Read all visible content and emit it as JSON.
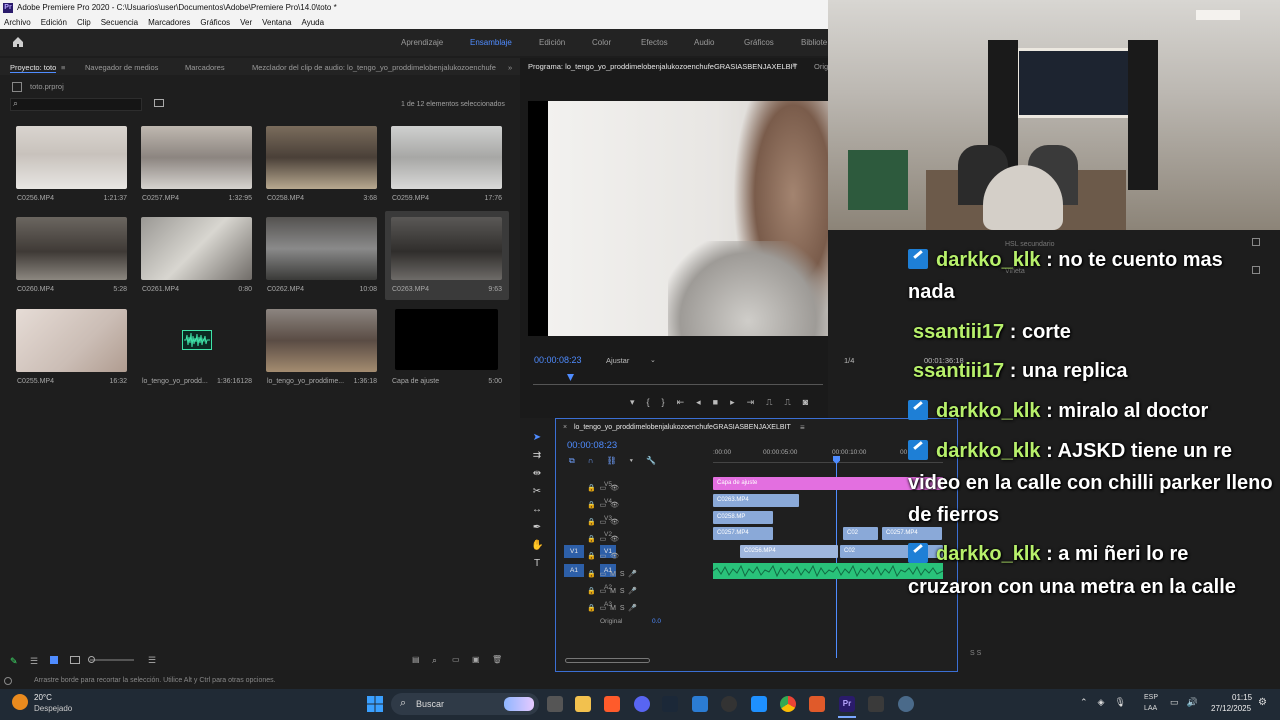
{
  "window": {
    "title": "Adobe Premiere Pro 2020 - C:\\Usuarios\\user\\Documentos\\Adobe\\Premiere Pro\\14.0\\toto *"
  },
  "menu": [
    "Archivo",
    "Edición",
    "Clip",
    "Secuencia",
    "Marcadores",
    "Gráficos",
    "Ver",
    "Ventana",
    "Ayuda"
  ],
  "workspaces": [
    "Aprendizaje",
    "Ensamblaje",
    "Edición",
    "Color",
    "Efectos",
    "Audio",
    "Gráficos",
    "Bibliote"
  ],
  "project_tabs": {
    "project": "Proyecto: toto",
    "media": "Navegador de medios",
    "markers": "Marcadores",
    "audio_mixer": "Mezclador del clip de audio: lo_tengo_yo_proddimelobenjalukozoenchufe"
  },
  "project": {
    "file": "toto.prproj",
    "selection": "1 de 12 elementos seleccionados"
  },
  "clips": [
    {
      "name": "C0256.MP4",
      "duration": "1:21:37"
    },
    {
      "name": "C0257.MP4",
      "duration": "1:32:95"
    },
    {
      "name": "C0258.MP4",
      "duration": "3:68"
    },
    {
      "name": "C0259.MP4",
      "duration": "17:76"
    },
    {
      "name": "C0260.MP4",
      "duration": "5:28"
    },
    {
      "name": "C0261.MP4",
      "duration": "0:80"
    },
    {
      "name": "C0262.MP4",
      "duration": "10:08"
    },
    {
      "name": "C0263.MP4",
      "duration": "9:63"
    },
    {
      "name": "C0255.MP4",
      "duration": "16:32"
    },
    {
      "name": "lo_tengo_yo_prodd...",
      "duration": "1:36:16128"
    },
    {
      "name": "lo_tengo_yo_proddime...",
      "duration": "1:36:18"
    },
    {
      "name": "Capa de ajuste",
      "duration": "5:00"
    }
  ],
  "program": {
    "title": "Programa: lo_tengo_yo_proddimelobenjalukozoenchufeGRASIASBENJAXELBIT",
    "orig": "Orig",
    "timecode": "00:00:08:23",
    "fit": "Ajustar",
    "fraction": "1/4",
    "duration": "00:01:36:18"
  },
  "sequence": {
    "name": "lo_tengo_yo_proddimelobenjalukozoenchufeGRASIASBENJAXELBIT",
    "timecode": "00:00:08:23",
    "ruler": [
      ":00:00",
      "00:00:05:00",
      "00:00:10:00",
      "00"
    ]
  },
  "tracks": {
    "video": [
      "V5",
      "V4",
      "V3",
      "V2",
      "V1"
    ],
    "audio": [
      "A1",
      "A2",
      "A3"
    ],
    "master": "Original",
    "master_val": "0.0"
  },
  "timeline_clips": {
    "v5": "Capa de ajuste",
    "v4": "C0263.MP4",
    "v3": "C0258.MP",
    "v2a": "C0257.MP4",
    "v2b": "C02",
    "v2c": "C0257.MP4",
    "v1a": "C0256.MP4",
    "v1b": "C02"
  },
  "right_panel": {
    "hsl": "HSL secundario",
    "vignette": "Viñeta"
  },
  "status": "Arrastre borde para recortar la selección. Utilice Alt y Ctrl para otras opciones.",
  "chat": [
    {
      "user": "darkko_klk",
      "badge": true,
      "msg": "no te cuento mas",
      "cont": "nada"
    },
    {
      "user": "ssantiii17",
      "badge": false,
      "msg": "corte"
    },
    {
      "user": "ssantiii17",
      "badge": false,
      "msg": "una replica"
    },
    {
      "user": "darkko_klk",
      "badge": true,
      "msg": "miralo al doctor"
    },
    {
      "user": "darkko_klk",
      "badge": true,
      "msg": "AJSKD tiene un re",
      "cont": "video en la calle con chilli parker lleno",
      "cont2": "de fierros"
    },
    {
      "user": "darkko_klk",
      "badge": true,
      "msg": "a mi ñeri lo re",
      "cont": "cruzaron con una metra en la calle"
    }
  ],
  "taskbar": {
    "temp": "20°C",
    "weather": "Despejado",
    "search": "Buscar",
    "lang1": "ESP",
    "lang2": "LAA",
    "time": "01:15",
    "date": "27/12/2025"
  },
  "colors": {
    "accent": "#4f8cff",
    "chat_user": "#b7f06b",
    "clip_pink": "#e36fe0",
    "clip_blue": "#8aa9d8",
    "audio_green": "#29c27a"
  }
}
